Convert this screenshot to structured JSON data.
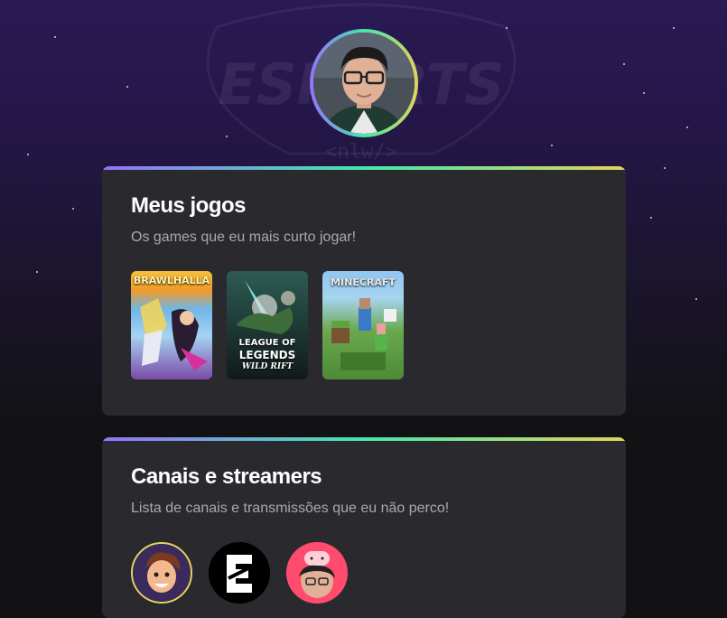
{
  "profile": {
    "avatar_alt": "Foto de perfil"
  },
  "background": {
    "logo_text": "ESPORTS",
    "logo_sub": "<nlw/>"
  },
  "games_section": {
    "title": "Meus jogos",
    "subtitle": "Os games que eu mais curto jogar!",
    "games": [
      {
        "name": "BRAWLHALLA",
        "icon": "brawlhalla-cover"
      },
      {
        "name_line1": "LEAGUE OF",
        "name_line2": "LEGENDS",
        "name_line3": "WILD RIFT",
        "icon": "wild-rift-cover"
      },
      {
        "name": "MINECRAFT",
        "icon": "minecraft-cover"
      }
    ]
  },
  "streamers_section": {
    "title": "Canais e streamers",
    "subtitle": "Lista de canais e transmissões que eu não perco!",
    "streamers": [
      {
        "icon": "streamer-avatar-1",
        "ring_color": "#e2d45c"
      },
      {
        "icon": "streamer-avatar-2"
      },
      {
        "icon": "streamer-avatar-3"
      }
    ]
  },
  "colors": {
    "accent_purple": "#9572fc",
    "accent_green": "#43e7ad",
    "accent_yellow": "#e2d45c",
    "card_bg": "#29292e",
    "page_bg": "#121214"
  }
}
